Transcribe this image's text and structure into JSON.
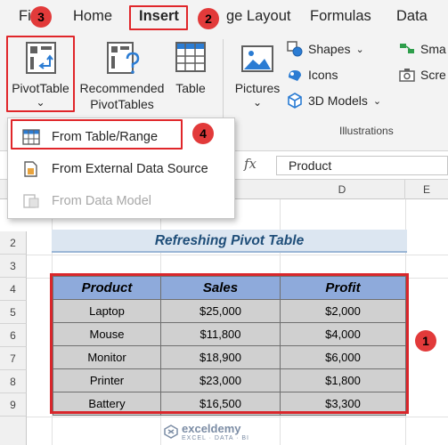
{
  "menu": {
    "file": "Fi",
    "home": "Home",
    "insert": "Insert",
    "page_layout": "ge Layout",
    "formulas": "Formulas",
    "data": "Data"
  },
  "badges": {
    "one": "1",
    "two": "2",
    "three": "3",
    "four": "4"
  },
  "ribbon": {
    "pivot_table": "PivotTable",
    "pivot_caret": "⌄",
    "recommended_line1": "Recommended",
    "recommended_line2": "PivotTables",
    "table": "Table",
    "pictures": "Pictures",
    "pictures_caret": "⌄",
    "shapes": "Shapes",
    "shapes_caret": "⌄",
    "icons": "Icons",
    "models_3d": "3D Models",
    "models_caret": "⌄",
    "smartart": "Sma",
    "screenshot": "Scre",
    "illustrations_group": "Illustrations"
  },
  "dropdown": {
    "from_table": "From Table/Range",
    "from_external": "From External Data Source",
    "from_model": "From Data Model"
  },
  "formula_bar": {
    "fx": "fx",
    "value": "Product"
  },
  "columns": [
    "D",
    "E"
  ],
  "rows": [
    "2",
    "3",
    "4",
    "5",
    "6",
    "7",
    "8",
    "9"
  ],
  "sheet": {
    "title": "Refreshing Pivot Table",
    "headers": [
      "Product",
      "Sales",
      "Profit"
    ],
    "rows": [
      [
        "Laptop",
        "$25,000",
        "$2,000"
      ],
      [
        "Mouse",
        "$11,800",
        "$4,000"
      ],
      [
        "Monitor",
        "$18,900",
        "$6,000"
      ],
      [
        "Printer",
        "$23,000",
        "$1,800"
      ],
      [
        "Battery",
        "$16,500",
        "$3,300"
      ]
    ]
  },
  "watermark": {
    "name": "exceldemy",
    "sub": "EXCEL · DATA · BI"
  },
  "colors": {
    "accent_red": "#e0262a",
    "header_blue": "#8eaadb",
    "cell_gray": "#d0d0d0",
    "title_bg": "#dce6f1"
  }
}
